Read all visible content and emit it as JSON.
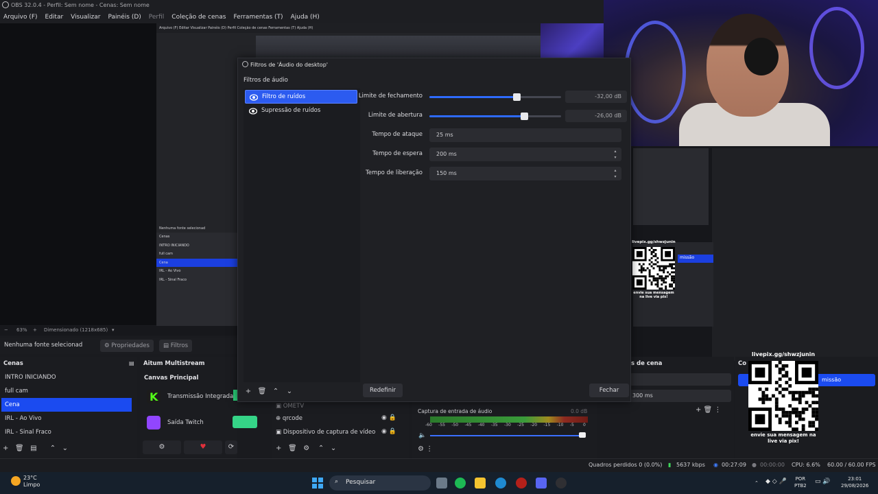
{
  "titlebar": {
    "title": "OBS 32.0.4 - Perfil: Sem nome - Cenas: Sem nome"
  },
  "menu": [
    {
      "label": "Arquivo (F)"
    },
    {
      "label": "Editar"
    },
    {
      "label": "Visualizar"
    },
    {
      "label": "Painéis (D)"
    },
    {
      "label": "Perfil"
    },
    {
      "label": "Coleção de cenas"
    },
    {
      "label": "Ferramentas (T)"
    },
    {
      "label": "Ajuda (H)"
    }
  ],
  "nested": {
    "menu": "Arquivo (F)   Editar   Visualizar   Painéis (D)   Perfil   Coleção de cenas   Ferramentas (T)   Ajuda (H)",
    "source_label": "Nenhuma fonte selecionad",
    "scenes": [
      "Cenas",
      "INTRO INICIANDO",
      "full cam",
      "Cena",
      "IRL - Ao Vivo",
      "IRL - Sinal Fraco"
    ]
  },
  "dialog": {
    "title": "Filtros de 'Áudio do desktop'",
    "section_label": "Filtros de áudio",
    "filters": [
      {
        "label": "Filtro de ruídos",
        "selected": true
      },
      {
        "label": "Supressão de ruídos",
        "selected": false
      }
    ],
    "params": {
      "close_label": "Limite de fechamento",
      "close_value": "-32,00 dB",
      "close_fraction": 0.66,
      "open_label": "Limite de abertura",
      "open_value": "-26,00 dB",
      "open_fraction": 0.72,
      "attack_label": "Tempo de ataque",
      "attack_value": "25 ms",
      "hold_label": "Tempo de espera",
      "hold_value": "200 ms",
      "release_label": "Tempo de liberação",
      "release_value": "150 ms"
    },
    "reset_label": "Redefinir",
    "close_label": "Fechar"
  },
  "zoombar": {
    "zoom": "63%",
    "scale": "Dimensionado (1218x685)"
  },
  "source_bar": {
    "none_selected": "Nenhuma fonte selecionad",
    "properties": "Propriedades",
    "filters": "Filtros"
  },
  "scenes": {
    "header": "Cenas",
    "items": [
      "INTRO INICIANDO",
      "full cam",
      "Cena",
      "IRL - Ao Vivo",
      "IRL - Sinal Fraco"
    ],
    "selected_index": 2
  },
  "multistream": {
    "header": "Aitum Multistream",
    "canvas": "Canvas Principal",
    "outputs": [
      {
        "name": "Transmissão Integrada",
        "color": "#53fc18"
      },
      {
        "name": "Saída Twitch",
        "color": "#9146ff"
      }
    ]
  },
  "sources": {
    "items": [
      "OMETV",
      "qrcode",
      "Dispositivo de captura de vídeo"
    ]
  },
  "mixer": {
    "label": "Captura de entrada de áudio",
    "db": "0.0 dB",
    "ticks": [
      "-60",
      "-55",
      "-50",
      "-45",
      "-40",
      "-35",
      "-30",
      "-25",
      "-20",
      "-15",
      "-10",
      "-5",
      "0"
    ],
    "volume_fraction": 0.98
  },
  "transitions": {
    "header": "s de cena",
    "duration": "300 ms"
  },
  "controls": {
    "header": "Co",
    "selected": "missão"
  },
  "qr": {
    "caption_top": "livepix.gg/shwzjunin",
    "caption_bottom": "envie sua mensagem na live via pix!"
  },
  "status": {
    "dropped": "Quadros perdidos 0 (0.0%)",
    "bitrate": "5637 kbps",
    "stream_time": "00:27:09",
    "rec_time": "00:00:00",
    "cpu": "CPU: 6.6%",
    "fps": "60.00 / 60.00 FPS"
  },
  "taskbar": {
    "temp": "23°C",
    "weather": "Limpo",
    "search": "Pesquisar",
    "lang1": "POR",
    "lang2": "PTB2",
    "time": "23:01",
    "date": "29/08/2026"
  },
  "colors": {
    "accent": "#2c5bf0",
    "selection": "#1b4bf0",
    "bg": "#1f2024"
  }
}
